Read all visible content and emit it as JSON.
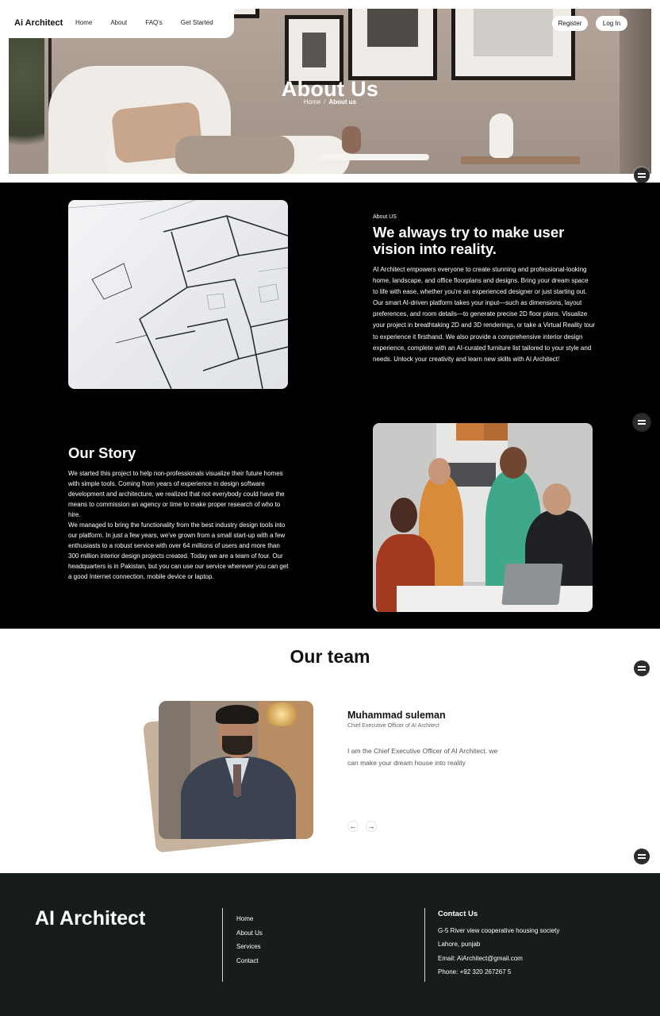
{
  "nav": {
    "brand": "Ai Architect",
    "links": [
      "Home",
      "About",
      "FAQ's",
      "Get Started"
    ],
    "register": "Register",
    "login": "Log In"
  },
  "hero": {
    "title": "About Us",
    "breadcrumb": {
      "home": "Home",
      "separator": "/",
      "current": "About us"
    }
  },
  "about": {
    "kicker": "About US",
    "heading": "We always try to make user vision into reality.",
    "body": "AI Architect empowers everyone to create stunning and professional-looking home, landscape, and office floorplans and designs. Bring your dream space to life with ease, whether you're an experienced designer or just starting out. Our smart AI-driven platform takes your input—such as dimensions, layout preferences, and room details—to generate precise 2D floor plans. Visualize your project in breathtaking 2D and 3D renderings, or take a Virtual Reality tour to experience it firsthand. We also provide a comprehensive interior design experience, complete with an AI-curated furniture list tailored to your style and needs. Unlock your creativity and learn new skills with AI Architect!"
  },
  "story": {
    "heading": "Our Story",
    "paragraphs": [
      "We started this project to help non-professionals visualize their future homes with simple tools. Coming from years of experience in design software development and architecture, we realized that not everybody could have the means to commission an agency or time to make proper research of who to hire.",
      "We managed to bring the functionality from the best industry design tools into our platform. In just a few years, we've grown from a small start-up with a few enthusiasts to a robust service with over 64 millions of users and more than 300 million interior design projects created. Today we are a team of four. Our headquarters is in Pakistan, but you can use our service wherever you can get a good Internet connection, mobile device or laptop."
    ]
  },
  "team": {
    "title": "Our team",
    "member": {
      "name": "Muhammad suleman",
      "role": "Chief Executive Officer of AI Architect",
      "bio": "I am the Chief Executive Officer of AI Architect. we can make your dream house into reality"
    },
    "prev": "←",
    "next": "→"
  },
  "footer": {
    "brand": "AI Architect",
    "links": [
      "Home",
      "About Us",
      "Services",
      "Contact"
    ],
    "contact_heading": "Contact Us",
    "contact": [
      "G-5 River view cooperative housing society",
      "Lahore, punjab",
      "Email: AiArchitect@gmail.com",
      "Phone: +92 320 267267 5"
    ]
  },
  "icons": {
    "fab": "filter-list-icon"
  },
  "colors": {
    "dark_section": "#000000",
    "footer_bg": "#161d1b",
    "accent_text": "#ffffff"
  }
}
